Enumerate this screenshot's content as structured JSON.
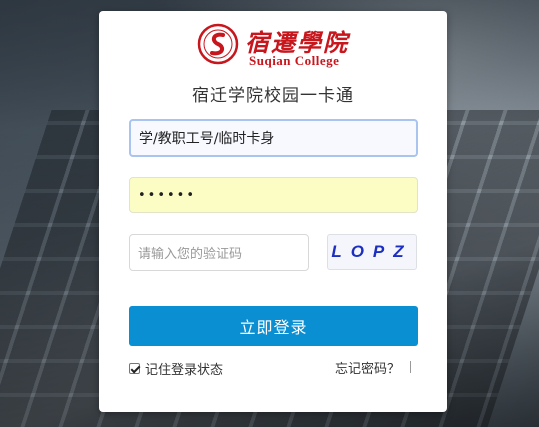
{
  "header": {
    "logo_cn": "宿遷學院",
    "logo_en": "Suqian College",
    "title": "宿迁学院校园一卡通"
  },
  "form": {
    "username_value": "学/教职工号/临时卡身",
    "password_value": "••••••",
    "captcha_placeholder": "请输入您的验证码",
    "captcha_code": "LOPZ",
    "login_label": "立即登录",
    "remember_label": "记住登录状态",
    "remember_checked": true,
    "forgot_label": "忘记密码？"
  },
  "colors": {
    "brand_red": "#c8161d",
    "button_blue": "#0a8fd2",
    "captcha_blue": "#1c2fbf"
  }
}
